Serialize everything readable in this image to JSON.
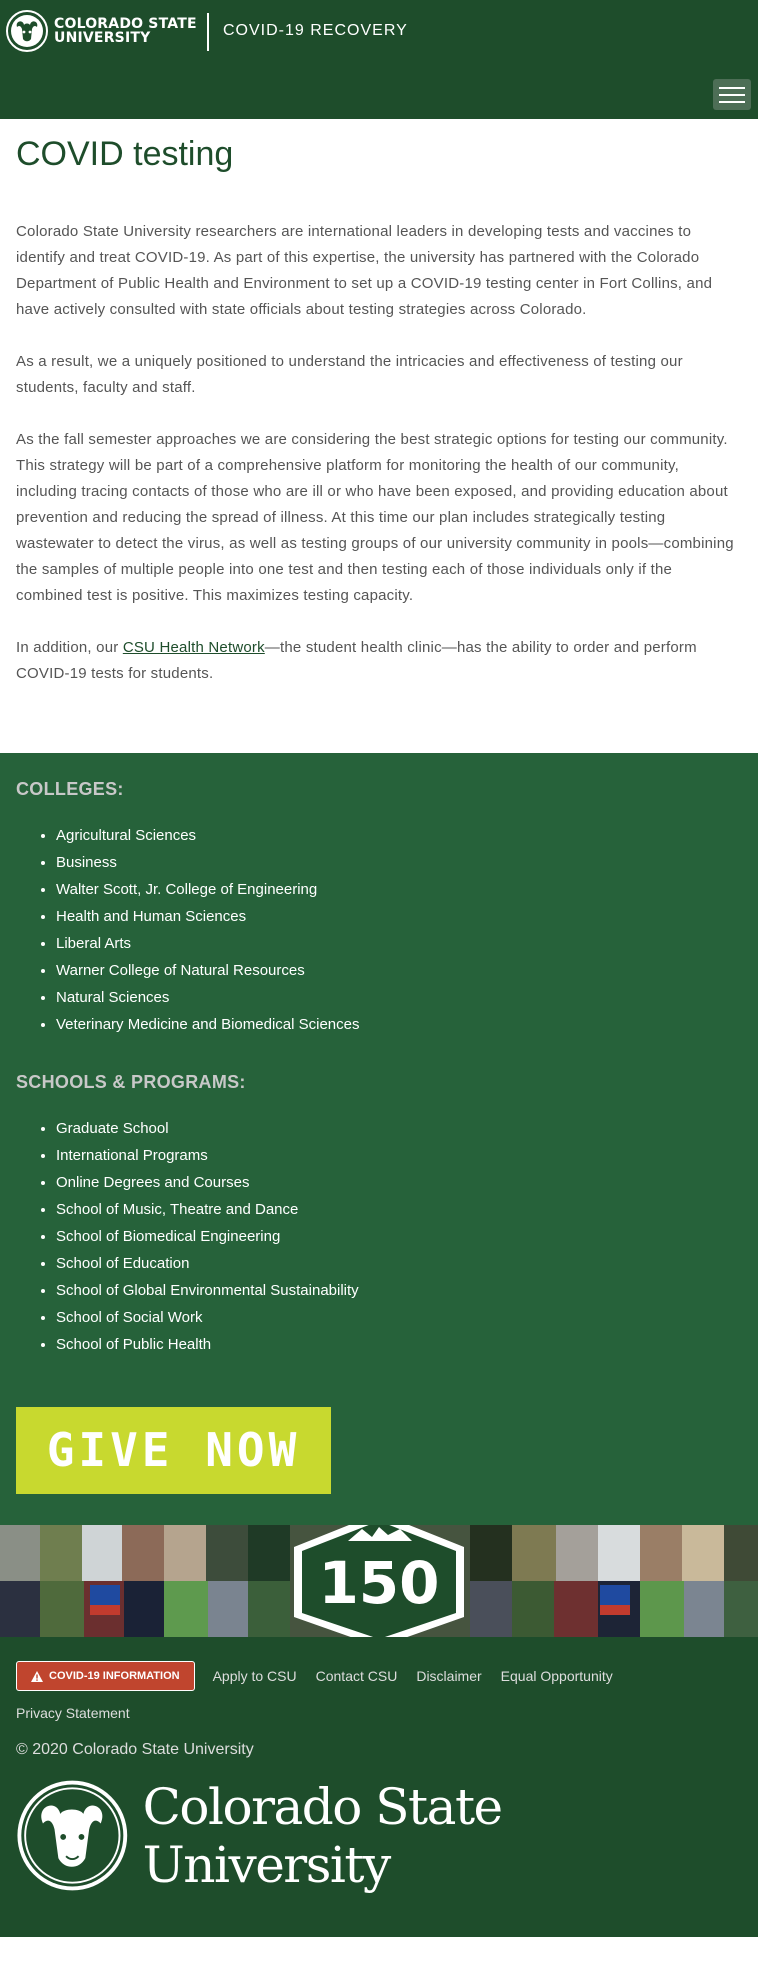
{
  "header": {
    "brand_line1": "COLORADO STATE",
    "brand_line2": "UNIVERSITY",
    "site_title": "COVID-19 RECOVERY"
  },
  "main": {
    "title": "COVID testing",
    "p1": "Colorado State University researchers are international leaders in developing tests and vaccines to identify and treat COVID-19. As part of this expertise, the university has partnered with the Colorado Department of Public Health and Environment to set up a COVID-19 testing center in Fort Collins, and have actively consulted with state officials about testing strategies across Colorado.",
    "p2": "As a result, we a uniquely positioned to understand the intricacies and effectiveness of testing our students, faculty and staff.",
    "p3": "As the fall semester approaches we are considering the best strategic options for testing our community. This strategy will be part of a comprehensive platform for monitoring the health of our community, including tracing contacts of those who are ill or who have been exposed, and providing education about prevention and reducing the spread of illness. At this time our plan includes strategically testing wastewater to detect the virus, as well as testing groups of our university community in pools—combining the samples of multiple people into one test and then testing each of those individuals only if the combined test is positive. This maximizes testing capacity.",
    "p4_before": "In addition, our ",
    "p4_link": "CSU Health Network",
    "p4_after": "—the student health clinic—has the ability to order and perform COVID-19 tests for students."
  },
  "footer": {
    "colleges_heading": "COLLEGES:",
    "colleges": [
      "Agricultural Sciences",
      "Business",
      "Walter Scott, Jr. College of Engineering",
      "Health and Human Sciences",
      "Liberal Arts",
      "Warner College of Natural Resources",
      "Natural Sciences",
      "Veterinary Medicine and Biomedical Sciences"
    ],
    "schools_heading": "SCHOOLS & PROGRAMS:",
    "schools": [
      "Graduate School",
      "International Programs",
      "Online Degrees and Courses",
      "School of Music, Theatre and Dance",
      "School of Biomedical Engineering",
      "School of Education",
      "School of Global Environmental Sustainability",
      "School of Social Work",
      "School of Public Health"
    ],
    "give_label": "GIVE NOW",
    "badge_number": "150"
  },
  "bottom": {
    "covid_button": "COVID-19 INFORMATION",
    "links": [
      "Apply to CSU",
      "Contact CSU",
      "Disclaimer",
      "Equal Opportunity",
      "Privacy Statement"
    ],
    "copyright": "© 2020 Colorado State University",
    "signature": "Colorado State University"
  },
  "colors": {
    "brand_green": "#1e4d2b",
    "footer_green": "#26623a",
    "give_yellow": "#c8d92f",
    "covid_red": "#c0452e"
  },
  "icons": [
    "ram-logo-icon",
    "hamburger-menu-icon",
    "warning-icon",
    "anniversary-150-badge"
  ]
}
